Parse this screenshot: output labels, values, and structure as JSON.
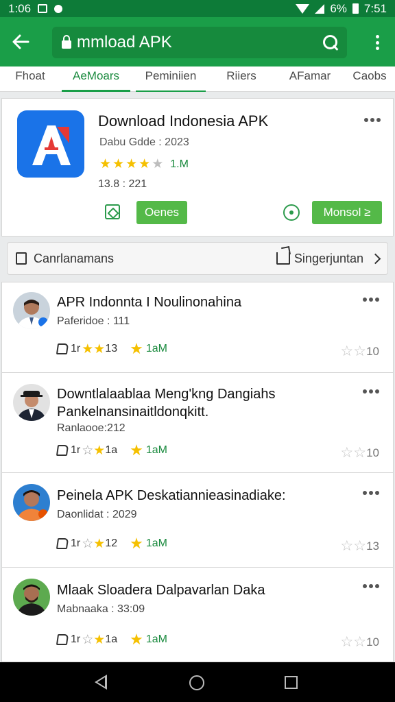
{
  "status_bar": {
    "time": "1:06",
    "battery": "6%",
    "clock_right": "7:51"
  },
  "top_bar": {
    "search_text": "mmload APK"
  },
  "tabs": [
    {
      "label": "Fhoat"
    },
    {
      "label": "AeMoars"
    },
    {
      "label": "Peminiien"
    },
    {
      "label": "Riiers"
    },
    {
      "label": "AFamar"
    },
    {
      "label": "Caobs"
    }
  ],
  "app": {
    "title": "Download Indonesia APK",
    "developer": "Dabu Gdde : 2023",
    "rating_stars": 4,
    "rating_count": "1.M",
    "meta": "13.8 : 221",
    "open_label": "Oenes",
    "install_label": "Monsol ≥",
    "colors": {
      "icon_bg": "#1a73e8",
      "accent": "#54b948"
    }
  },
  "category_bar": {
    "label": "Canrlanamans",
    "share_label": "Singerjuntan"
  },
  "reviews": [
    {
      "title": "APR Indonnta I Noulinonahina",
      "subtitle": "Paferidoe : 111",
      "likes": "1r",
      "star_count": "13",
      "green_count": "1aM",
      "right_count": "10"
    },
    {
      "title": "Downtlalaablaa Meng'kng Dangiahs Pankelnansinaitldonqkitt.",
      "subtitle": "Ranlaooe:212",
      "likes": "1r",
      "star_count": "1a",
      "green_count": "1aM",
      "right_count": "10"
    },
    {
      "title": "Peinela APK Deskatiannieasinadiake:",
      "subtitle": "Daonlidat : 2029",
      "likes": "1r",
      "star_count": "12",
      "green_count": "1aM",
      "right_count": "13"
    },
    {
      "title": "Mlaak Sloadera Dalpavarlan Daka",
      "subtitle": "Mabnaaka : 33:09",
      "likes": "1r",
      "star_count": "1a",
      "green_count": "1aM",
      "right_count": "10"
    }
  ]
}
